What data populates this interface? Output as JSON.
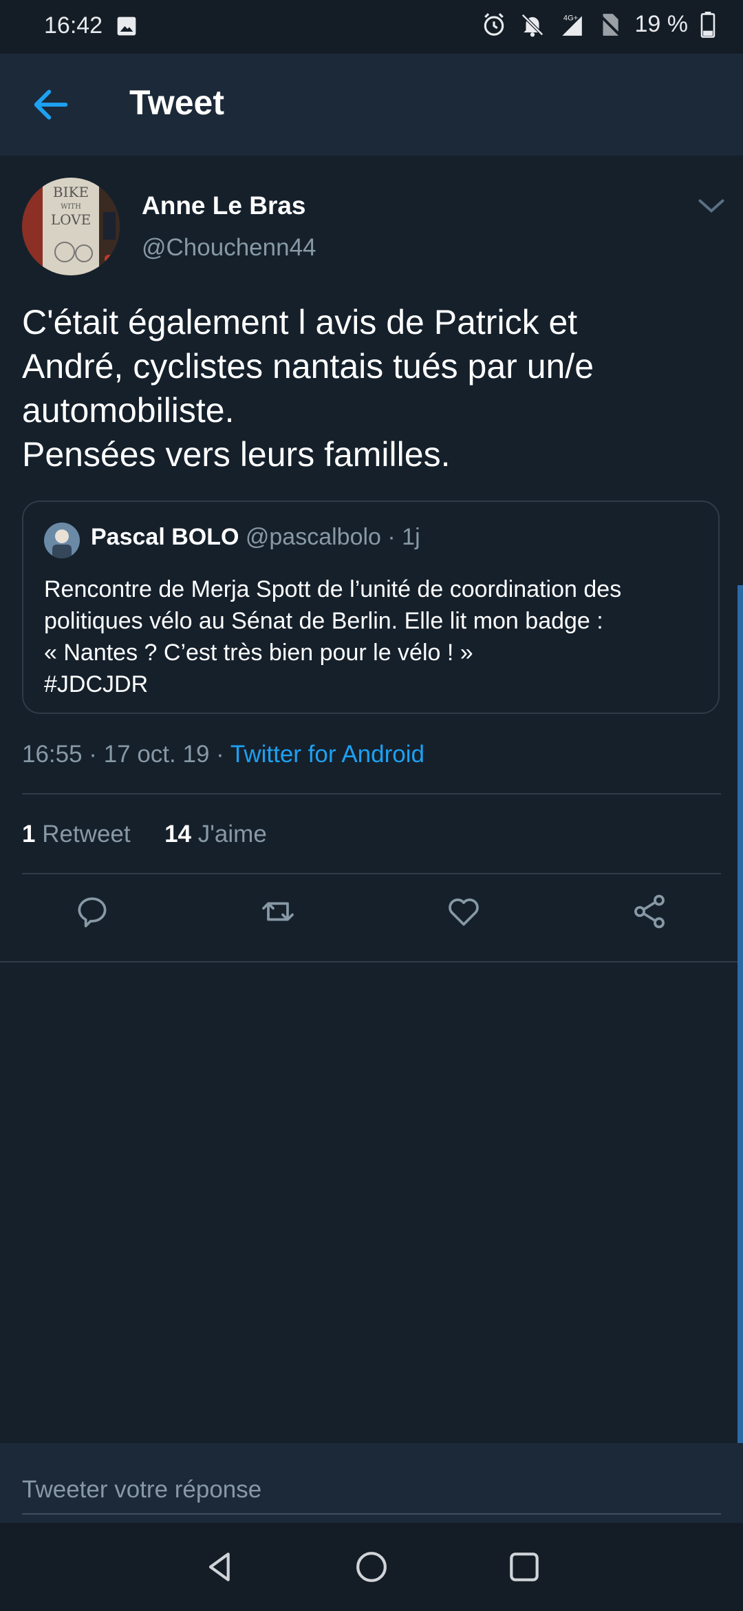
{
  "status_bar": {
    "time": "16:42",
    "network": "4G+",
    "battery": "19 %",
    "icons": [
      "image-icon",
      "alarm-icon",
      "bell-off-icon",
      "signal-icon",
      "no-sim-icon",
      "battery-icon"
    ]
  },
  "app_bar": {
    "title": "Tweet",
    "back_icon": "arrow-left-icon"
  },
  "tweet": {
    "author_name": "Anne Le Bras",
    "author_handle": "@Chouchenn44",
    "avatar_text": [
      "BIKE",
      "WITH",
      "LOVE"
    ],
    "text": "C'était également l avis de Patrick et\nAndré, cyclistes nantais tués par un/e\nautomobiliste.\nPensées vers leurs familles.",
    "quote": {
      "name": "Pascal BOLO",
      "handle": "@pascalbolo",
      "time": " · 1j",
      "text": "Rencontre de Merja Spott de l’unité de coordination des\npolitiques vélo au Sénat de Berlin. Elle lit mon badge :\n« Nantes ? C’est très bien pour le vélo ! »\n#JDCJDR"
    },
    "timestamp": "16:55 · 17 oct. 19 · ",
    "source": "Twitter for Android",
    "retweet_count": "1",
    "retweet_label": "Retweet",
    "like_count": "14",
    "like_label": "J'aime"
  },
  "actions": [
    "reply-icon",
    "retweet-icon",
    "like-icon",
    "share-icon"
  ],
  "reply": {
    "placeholder": "Tweeter votre réponse"
  },
  "colors": {
    "background": "#15202b",
    "bar": "#1c2938",
    "accent": "#1da1f2",
    "secondary_text": "#8899a6"
  }
}
